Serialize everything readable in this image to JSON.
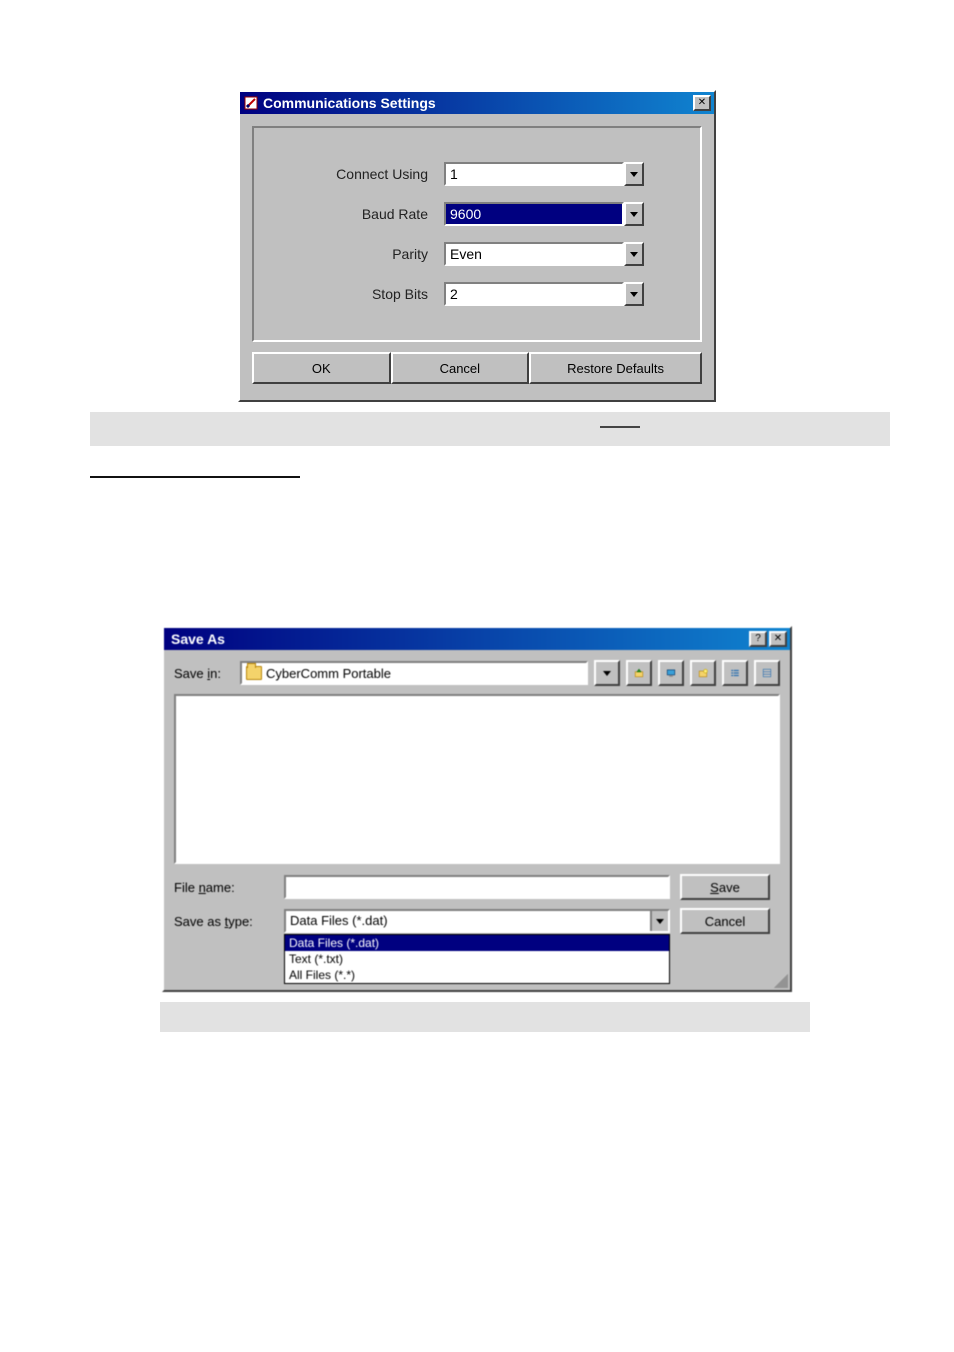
{
  "comm_dialog": {
    "title": "Communications Settings",
    "fields": {
      "connect_using": {
        "label": "Connect Using",
        "value": "1"
      },
      "baud_rate": {
        "label": "Baud Rate",
        "value": "9600"
      },
      "parity": {
        "label": "Parity",
        "value": "Even"
      },
      "stop_bits": {
        "label": "Stop Bits",
        "value": "2"
      }
    },
    "buttons": {
      "ok": "OK",
      "cancel": "Cancel",
      "restore": "Restore Defaults"
    },
    "close_glyph": "✕"
  },
  "saveas_dialog": {
    "title": "Save As",
    "help_glyph": "?",
    "close_glyph": "✕",
    "save_in_label": "Save in:",
    "save_in_value": "CyberComm Portable",
    "toolbar_icons": {
      "dropdown": "▼",
      "up": "up-one-level-icon",
      "desktop": "desktop-icon",
      "newfolder": "new-folder-icon",
      "list": "list-view-icon",
      "details": "details-view-icon"
    },
    "file_name_label": "File name:",
    "file_name_value": "",
    "save_as_type_label": "Save as type:",
    "save_as_type_value": "Data Files (*.dat)",
    "type_options": [
      "Data Files (*.dat)",
      "Text (*.txt)",
      "All Files (*.*)"
    ],
    "save_btn": "Save",
    "cancel_btn": "Cancel"
  }
}
